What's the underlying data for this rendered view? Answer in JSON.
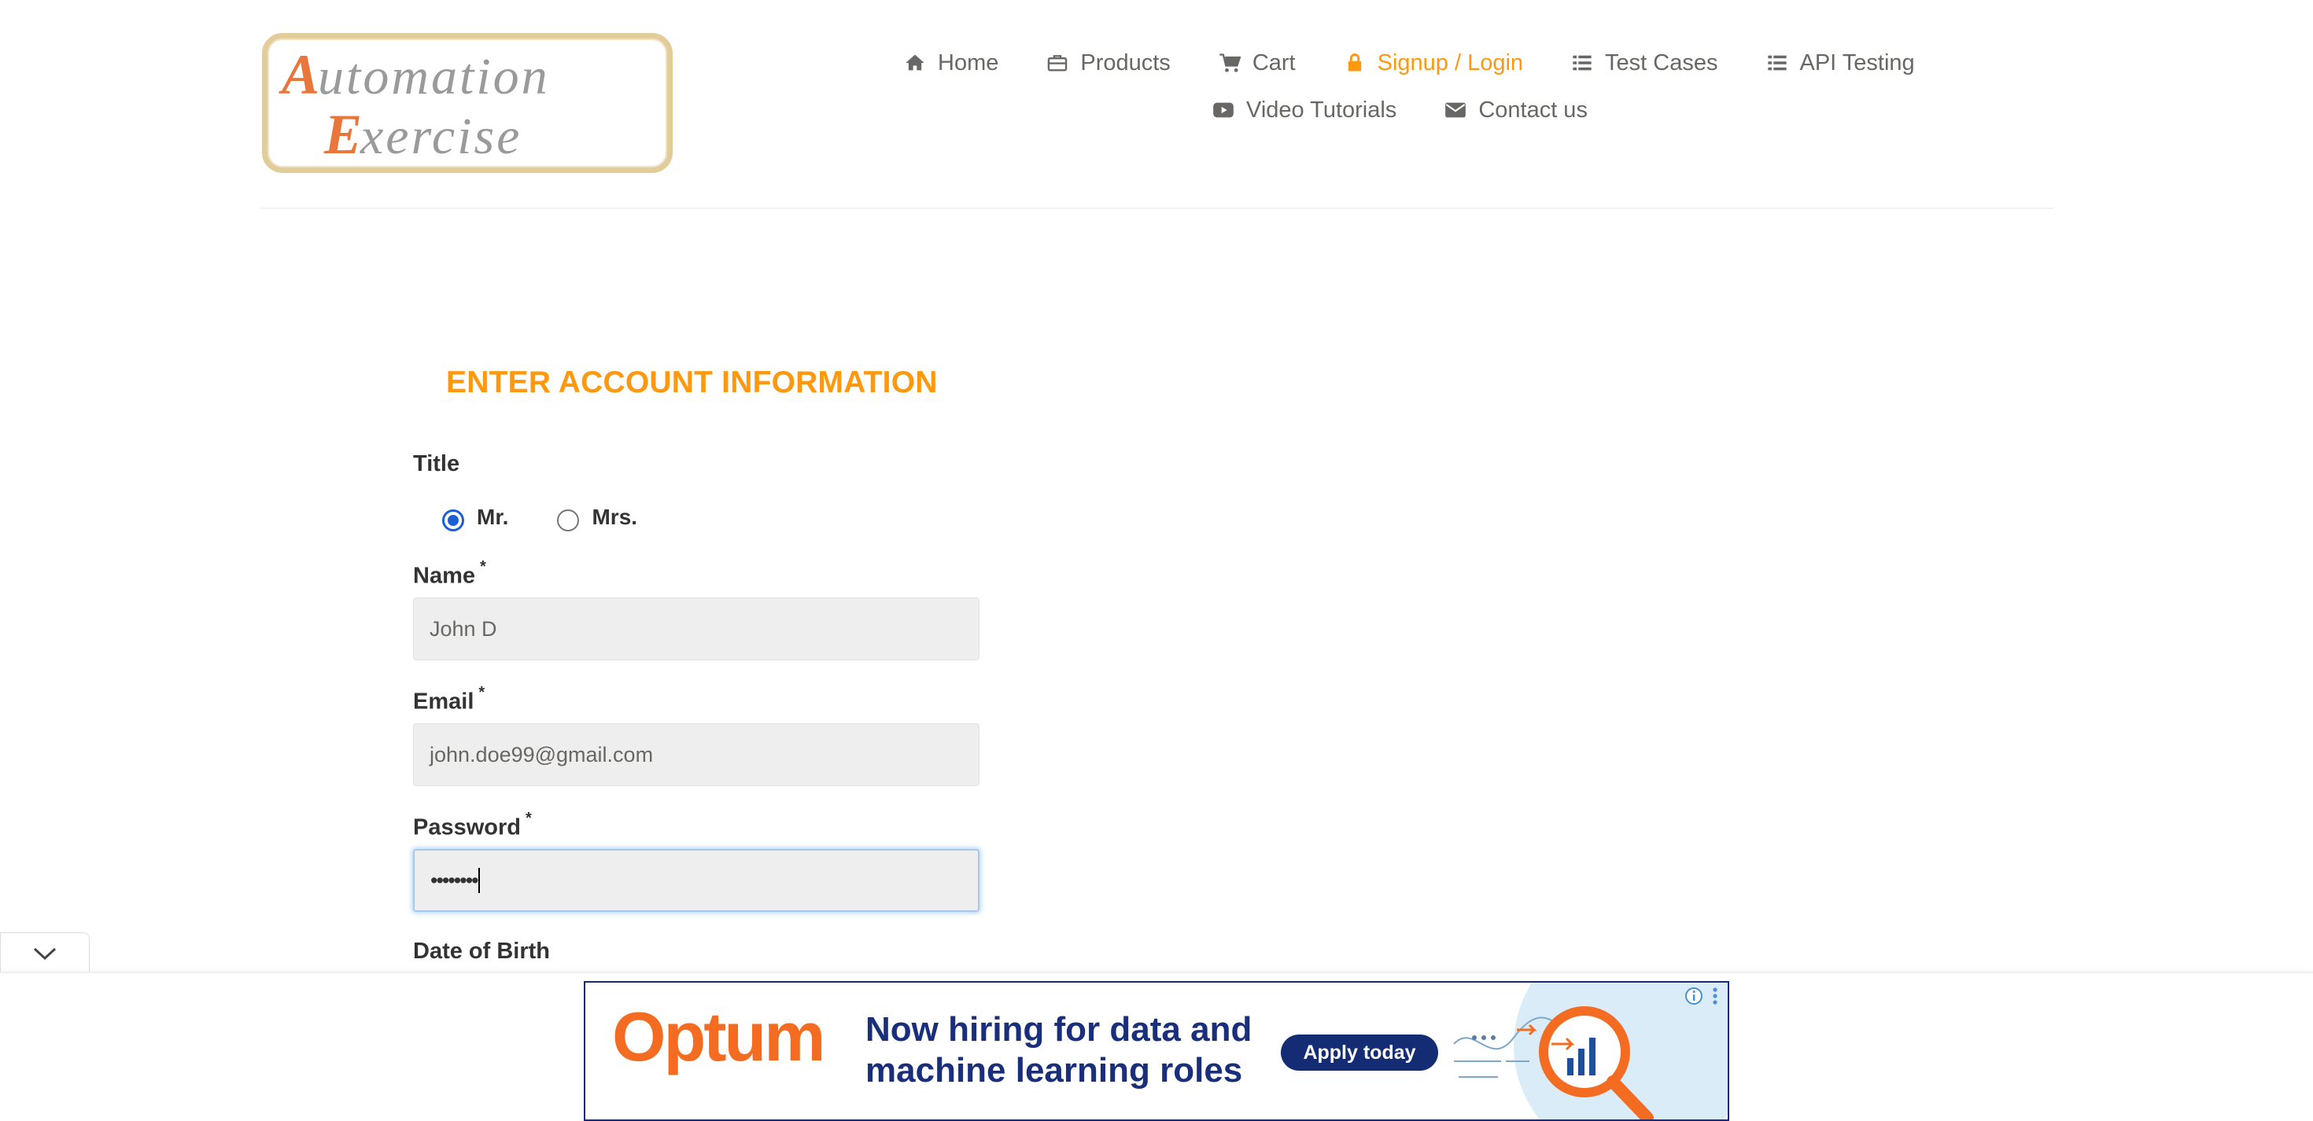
{
  "header": {
    "logo_text_line1": "Automation",
    "logo_text_line2": "Exercise",
    "nav": [
      {
        "label": "Home",
        "icon": "home-icon"
      },
      {
        "label": "Products",
        "icon": "briefcase-icon"
      },
      {
        "label": "Cart",
        "icon": "cart-icon"
      },
      {
        "label": "Signup / Login",
        "icon": "lock-icon",
        "active": true
      },
      {
        "label": "Test Cases",
        "icon": "list-icon"
      },
      {
        "label": "API Testing",
        "icon": "list-icon"
      },
      {
        "label": "Video Tutorials",
        "icon": "youtube-play-icon"
      },
      {
        "label": "Contact us",
        "icon": "envelope-icon"
      }
    ]
  },
  "form": {
    "heading": "ENTER ACCOUNT INFORMATION",
    "title_label": "Title",
    "title_options": [
      {
        "label": "Mr.",
        "checked": true
      },
      {
        "label": "Mrs.",
        "checked": false
      }
    ],
    "name_label": "Name",
    "name_value": "John D",
    "email_label": "Email",
    "email_value": "john.doe99@gmail.com",
    "password_label": "Password",
    "password_value": "••••••••",
    "required_marker": "*",
    "dob_label": "Date of Birth"
  },
  "ad": {
    "brand": "Optum",
    "headline": "Now hiring for data and machine learning roles",
    "cta": "Apply today"
  },
  "colors": {
    "accent": "#fe980f",
    "nav_text": "#696763",
    "ad_brand": "#f36c22",
    "ad_navy": "#142c74",
    "radio_checked": "#1a5fd6"
  }
}
